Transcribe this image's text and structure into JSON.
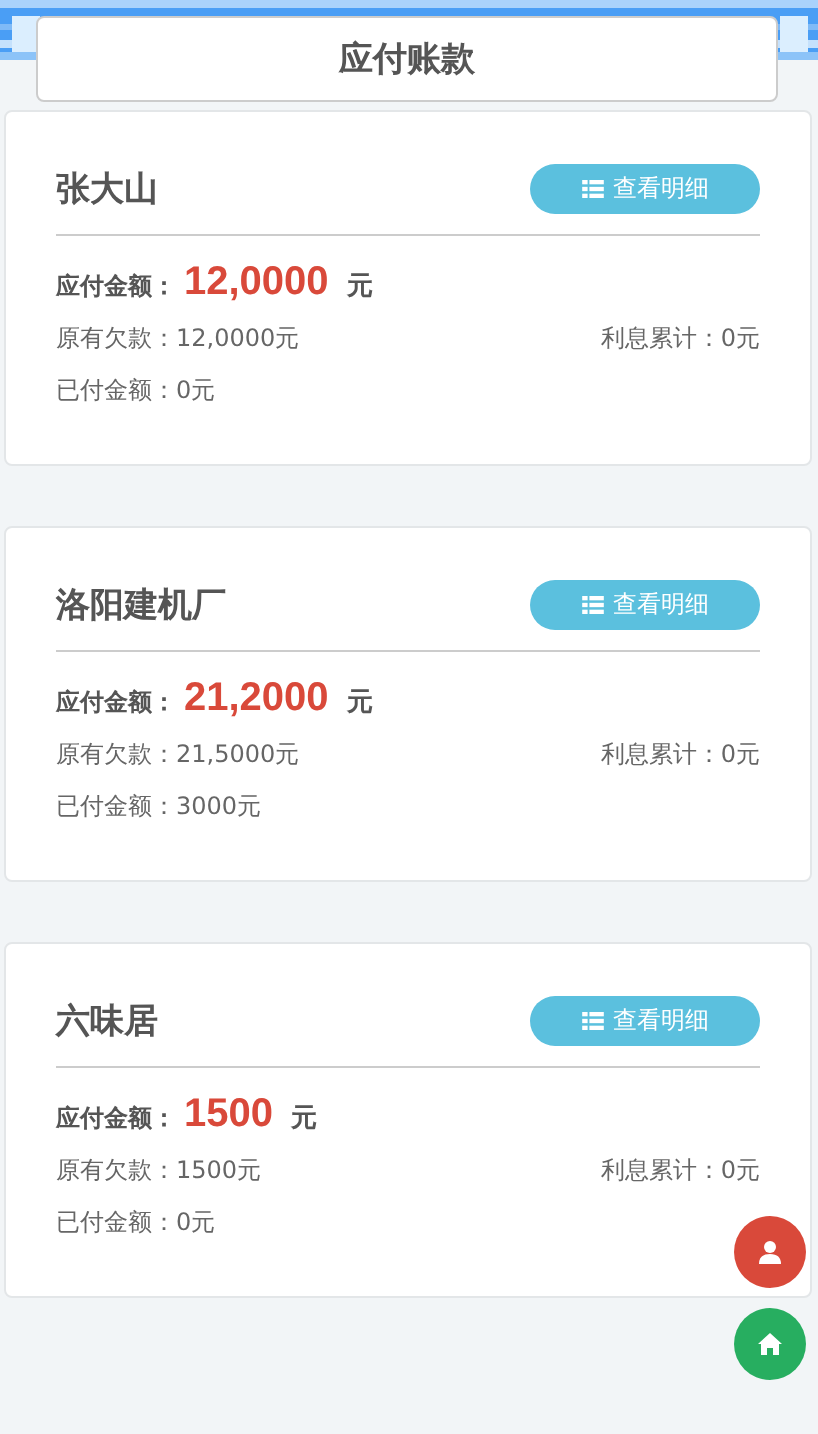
{
  "header": {
    "title": "应付账款"
  },
  "accounts": [
    {
      "name": "张大山",
      "button": "查看明细",
      "amount_label": "应付金额：",
      "amount": "12,0000",
      "unit": "元",
      "original_debt": "原有欠款：12,0000元",
      "interest": "利息累计：0元",
      "paid": "已付金额：0元"
    },
    {
      "name": "洛阳建机厂",
      "button": "查看明细",
      "amount_label": "应付金额：",
      "amount": "21,2000",
      "unit": "元",
      "original_debt": "原有欠款：21,5000元",
      "interest": "利息累计：0元",
      "paid": "已付金额：3000元"
    },
    {
      "name": "六味居",
      "button": "查看明细",
      "amount_label": "应付金额：",
      "amount": "1500",
      "unit": "元",
      "original_debt": "原有欠款：1500元",
      "interest": "利息累计：0元",
      "paid": "已付金额：0元"
    }
  ],
  "floating_buttons": [
    {
      "kind": "user",
      "color": "#d9493a"
    },
    {
      "kind": "home",
      "color": "#27ae60"
    }
  ]
}
